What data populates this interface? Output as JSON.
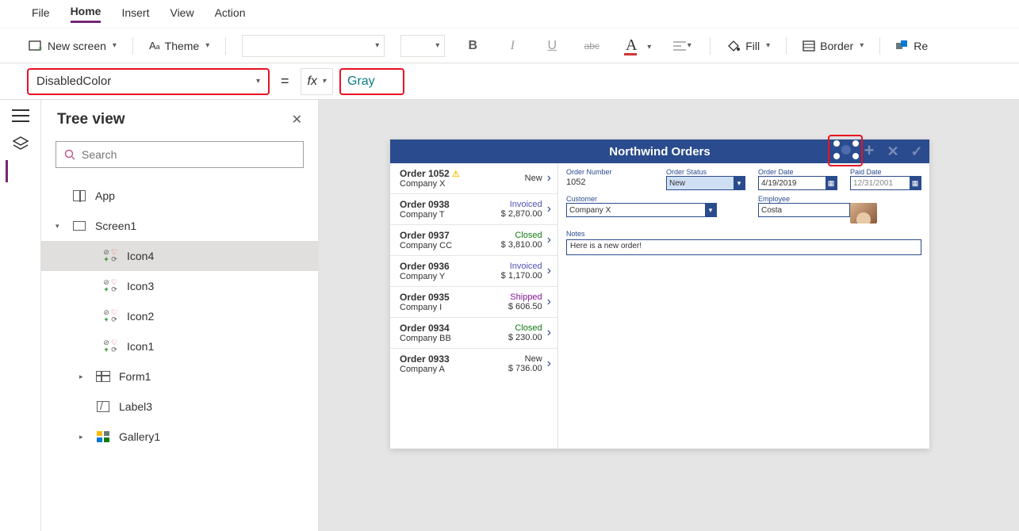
{
  "menu": {
    "items": [
      "File",
      "Home",
      "Insert",
      "View",
      "Action"
    ],
    "active": "Home"
  },
  "ribbon": {
    "new_screen": "New screen",
    "theme": "Theme",
    "fill": "Fill",
    "border": "Border",
    "reorder": "Re"
  },
  "formula": {
    "property": "DisabledColor",
    "fx": "fx",
    "value": "Gray"
  },
  "tree": {
    "title": "Tree view",
    "search_placeholder": "Search",
    "items": [
      {
        "label": "App",
        "type": "app",
        "level": 1,
        "expandable": false
      },
      {
        "label": "Screen1",
        "type": "screen",
        "level": 1,
        "expandable": true,
        "expanded": true
      },
      {
        "label": "Icon4",
        "type": "icon",
        "level": 3,
        "selected": true
      },
      {
        "label": "Icon3",
        "type": "icon",
        "level": 3
      },
      {
        "label": "Icon2",
        "type": "icon",
        "level": 3
      },
      {
        "label": "Icon1",
        "type": "icon",
        "level": 3
      },
      {
        "label": "Form1",
        "type": "form",
        "level": 2,
        "expandable": true
      },
      {
        "label": "Label3",
        "type": "label",
        "level": 2
      },
      {
        "label": "Gallery1",
        "type": "gallery",
        "level": 2,
        "expandable": true
      }
    ]
  },
  "app": {
    "title": "Northwind Orders",
    "orders": [
      {
        "title": "Order 1052",
        "company": "Company X",
        "status": "New",
        "status_cls": "st-new",
        "amount": "",
        "warn": true
      },
      {
        "title": "Order 0938",
        "company": "Company T",
        "status": "Invoiced",
        "status_cls": "st-invoiced",
        "amount": "$ 2,870.00"
      },
      {
        "title": "Order 0937",
        "company": "Company CC",
        "status": "Closed",
        "status_cls": "st-closed",
        "amount": "$ 3,810.00"
      },
      {
        "title": "Order 0936",
        "company": "Company Y",
        "status": "Invoiced",
        "status_cls": "st-invoiced",
        "amount": "$ 1,170.00"
      },
      {
        "title": "Order 0935",
        "company": "Company I",
        "status": "Shipped",
        "status_cls": "st-shipped",
        "amount": "$ 606.50"
      },
      {
        "title": "Order 0934",
        "company": "Company BB",
        "status": "Closed",
        "status_cls": "st-closed",
        "amount": "$ 230.00"
      },
      {
        "title": "Order 0933",
        "company": "Company A",
        "status": "New",
        "status_cls": "st-new",
        "amount": "$ 736.00"
      }
    ],
    "form": {
      "order_number_label": "Order Number",
      "order_number": "1052",
      "order_status_label": "Order Status",
      "order_status": "New",
      "order_date_label": "Order Date",
      "order_date": "4/19/2019",
      "paid_date_label": "Paid Date",
      "paid_date": "12/31/2001",
      "customer_label": "Customer",
      "customer": "Company X",
      "employee_label": "Employee",
      "employee": "Costa",
      "notes_label": "Notes",
      "notes": "Here is a new order!"
    }
  }
}
